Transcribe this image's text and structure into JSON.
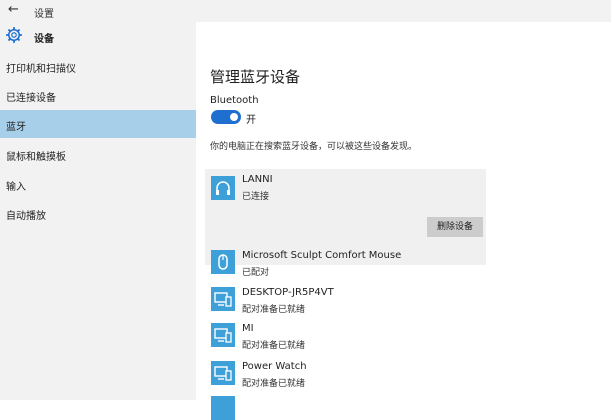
{
  "window": {
    "title": "设置",
    "back_icon": "back-arrow-icon"
  },
  "sidebar": {
    "title": "设备",
    "icon": "gear-icon",
    "items": [
      {
        "label": "打印机和扫描仪",
        "selected": false
      },
      {
        "label": "已连接设备",
        "selected": false
      },
      {
        "label": "蓝牙",
        "selected": true
      },
      {
        "label": "鼠标和触摸板",
        "selected": false
      },
      {
        "label": "输入",
        "selected": false
      },
      {
        "label": "自动播放",
        "selected": false
      }
    ]
  },
  "main": {
    "title": "管理蓝牙设备",
    "bluetooth_label": "Bluetooth",
    "toggle_state": "开",
    "toggle_on": true,
    "hint": "你的电脑正在搜索蓝牙设备，可以被这些设备发现。",
    "devices": [
      {
        "name": "LANNI",
        "status": "已连接",
        "icon": "headphones-icon",
        "selected": true,
        "action": "删除设备"
      },
      {
        "name": "Microsoft Sculpt Comfort Mouse",
        "status": "已配对",
        "icon": "mouse-icon"
      },
      {
        "name": "DESKTOP-JR5P4VT",
        "status": "配对准备已就绪",
        "icon": "computer-phone-icon"
      },
      {
        "name": "MI",
        "status": "配对准备已就绪",
        "icon": "computer-phone-icon"
      },
      {
        "name": "Power Watch",
        "status": "配对准备已就绪",
        "icon": "computer-phone-icon"
      }
    ]
  },
  "colors": {
    "accent": "#1e6fd0",
    "selected_nav": "#a8cfe9",
    "device_icon": "#3ea0d9"
  }
}
